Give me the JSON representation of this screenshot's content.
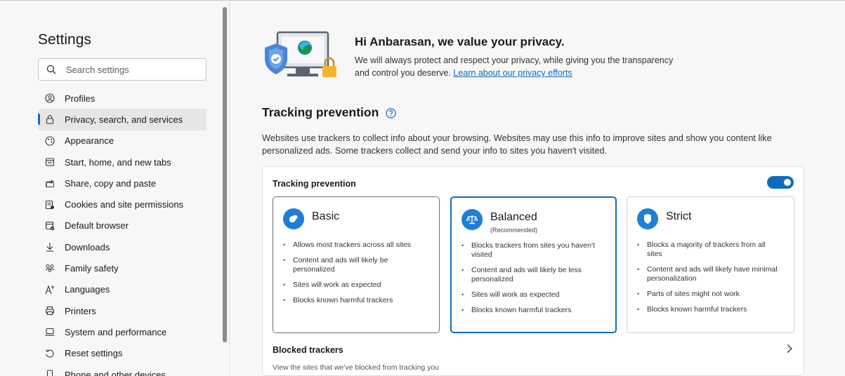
{
  "sidebar": {
    "title": "Settings",
    "search_placeholder": "Search settings",
    "items": [
      {
        "label": "Profiles",
        "icon": "profile-icon"
      },
      {
        "label": "Privacy, search, and services",
        "icon": "lock-icon",
        "active": true
      },
      {
        "label": "Appearance",
        "icon": "appearance-icon"
      },
      {
        "label": "Start, home, and new tabs",
        "icon": "home-tab-icon"
      },
      {
        "label": "Share, copy and paste",
        "icon": "share-icon"
      },
      {
        "label": "Cookies and site permissions",
        "icon": "cookie-icon"
      },
      {
        "label": "Default browser",
        "icon": "browser-icon"
      },
      {
        "label": "Downloads",
        "icon": "download-icon"
      },
      {
        "label": "Family safety",
        "icon": "family-icon"
      },
      {
        "label": "Languages",
        "icon": "language-icon"
      },
      {
        "label": "Printers",
        "icon": "printer-icon"
      },
      {
        "label": "System and performance",
        "icon": "laptop-icon"
      },
      {
        "label": "Reset settings",
        "icon": "reset-icon"
      },
      {
        "label": "Phone and other devices",
        "icon": "phone-icon"
      }
    ]
  },
  "hero": {
    "title": "Hi Anbarasan, we value your privacy.",
    "text_line1": "We will always protect and respect your privacy, while giving you the transparency",
    "text_line2": "and control you deserve.",
    "link": "Learn about our privacy efforts"
  },
  "tracking": {
    "title": "Tracking prevention",
    "description": "Websites use trackers to collect info about your browsing. Websites may use this info to improve sites and show you content like personalized ads. Some trackers collect and send your info to sites you haven't visited.",
    "card_label": "Tracking prevention",
    "enabled": true,
    "options": {
      "basic": {
        "name": "Basic",
        "bullets": [
          "Allows most trackers across all sites",
          "Content and ads will likely be personalized",
          "Sites will work as expected",
          "Blocks known harmful trackers"
        ]
      },
      "balanced": {
        "name": "Balanced",
        "subtitle": "(Recommended)",
        "bullets": [
          "Blocks trackers from sites you haven't visited",
          "Content and ads will likely be less personalized",
          "Sites will work as expected",
          "Blocks known harmful trackers"
        ]
      },
      "strict": {
        "name": "Strict",
        "bullets": [
          "Blocks a majority of trackers from all sites",
          "Content and ads will likely have minimal personalization",
          "Parts of sites might not work",
          "Blocks known harmful trackers"
        ]
      }
    },
    "blocked_title": "Blocked trackers",
    "blocked_desc": "View the sites that we've blocked from tracking you"
  },
  "colors": {
    "accent": "#0f6cbd",
    "icon_blue": "#1e7fd8"
  }
}
